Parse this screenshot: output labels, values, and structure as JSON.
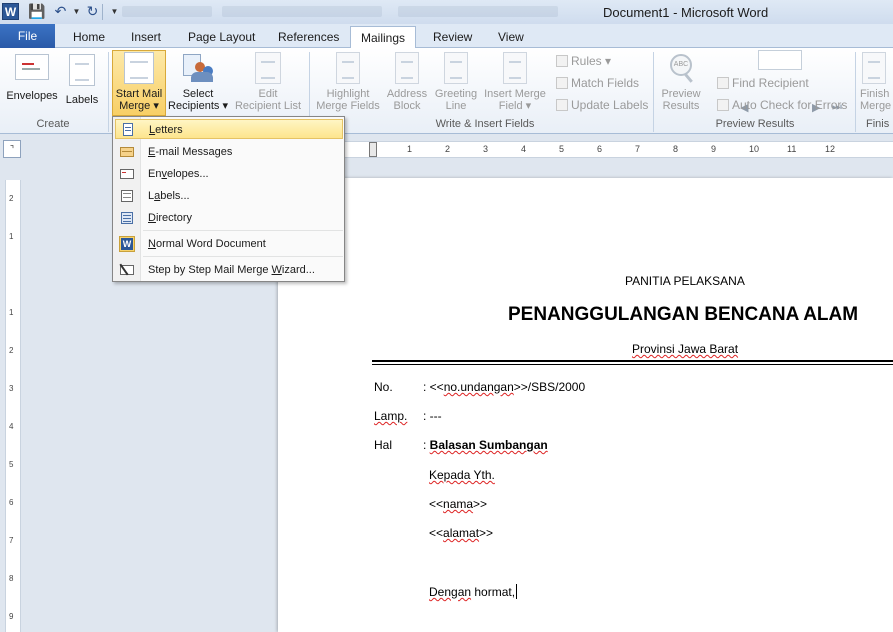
{
  "window": {
    "title": "Document1  -  Microsoft Word"
  },
  "qat": {
    "word_logo": "W"
  },
  "tabs": [
    {
      "label": "File"
    },
    {
      "label": "Home"
    },
    {
      "label": "Insert"
    },
    {
      "label": "Page Layout"
    },
    {
      "label": "References"
    },
    {
      "label": "Mailings"
    },
    {
      "label": "Review"
    },
    {
      "label": "View"
    }
  ],
  "active_tab": "Mailings",
  "ribbon": {
    "create": {
      "label": "Create",
      "envelopes": "Envelopes",
      "labels": "Labels"
    },
    "start": {
      "start_mail_merge_1": "Start Mail",
      "start_mail_merge_2": "Merge ▾",
      "select_recipients_1": "Select",
      "select_recipients_2": "Recipients ▾",
      "edit_list_1": "Edit",
      "edit_list_2": "Recipient List"
    },
    "write_insert": {
      "label": "Write & Insert Fields",
      "highlight_1": "Highlight",
      "highlight_2": "Merge Fields",
      "address_1": "Address",
      "address_2": "Block",
      "greeting_1": "Greeting",
      "greeting_2": "Line",
      "insert_1": "Insert Merge",
      "insert_2": "Field ▾",
      "rules": "Rules ▾",
      "match": "Match Fields",
      "update": "Update Labels"
    },
    "preview": {
      "label": "Preview Results",
      "preview_1": "Preview",
      "preview_2": "Results",
      "find": "Find Recipient",
      "auto_check": "Auto Check for Errors"
    },
    "finish": {
      "label": "Finis",
      "finish_1": "Finish",
      "finish_2": "Merge"
    }
  },
  "menu": {
    "items": [
      {
        "label": "Letters",
        "accel": "L",
        "icon": "letter-icon"
      },
      {
        "label": "E-mail Messages",
        "accel": "E",
        "icon": "email-icon"
      },
      {
        "label": "Envelopes...",
        "accel": "v",
        "icon": "envelope-icon"
      },
      {
        "label": "Labels...",
        "accel": "a",
        "icon": "labels-icon"
      },
      {
        "label": "Directory",
        "accel": "D",
        "icon": "directory-icon"
      },
      {
        "label": "Normal Word Document",
        "accel": "N",
        "icon": "word-doc-icon"
      },
      {
        "label": "Step by Step Mail Merge Wizard...",
        "accel": "W",
        "icon": "wizard-icon"
      }
    ]
  },
  "hruler_numbers": [
    "1",
    "2",
    "3",
    "4",
    "5",
    "6",
    "7",
    "8",
    "9",
    "10",
    "11",
    "12"
  ],
  "vruler_numbers": [
    "2",
    "1",
    "1",
    "2",
    "3",
    "4",
    "5",
    "6",
    "7",
    "8",
    "9"
  ],
  "document": {
    "org_line": "PANITIA PELAKSANA",
    "heading": "PENANGGULANGAN BENCANA ALAM",
    "province": "Provinsi Jawa Barat",
    "no_label": "No.",
    "no_prefix": ": <<",
    "no_field": "no.undangan",
    "no_suffix": ">>/SBS/2000",
    "lamp_label": "Lamp.",
    "lamp_value": ": ---",
    "hal_label": "Hal",
    "hal_colon": ": ",
    "hal_value": "Balasan Sumbangan",
    "kepada": "Kepada Yth.",
    "nama_prefix": "<<",
    "nama_field": "nama",
    "nama_suffix": ">>",
    "alamat_prefix": "<<",
    "alamat_field": "alamat",
    "alamat_suffix": ">>",
    "greeting_1": "Dengan",
    "greeting_2": " hormat,"
  }
}
